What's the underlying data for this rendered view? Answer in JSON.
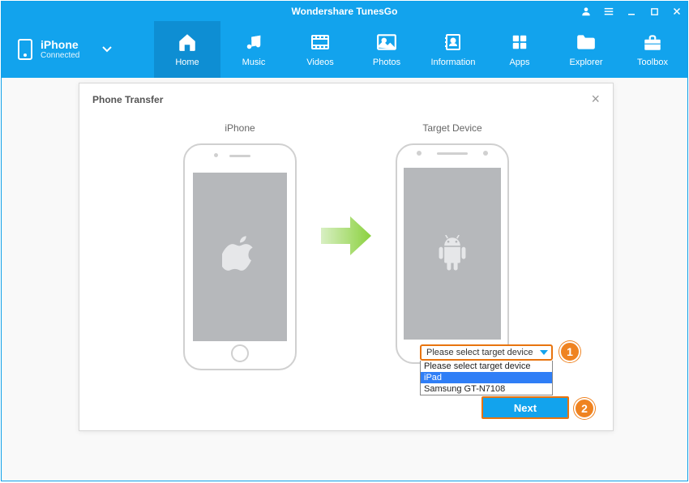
{
  "app": {
    "title": "Wondershare TunesGo"
  },
  "device": {
    "name": "iPhone",
    "status": "Connected"
  },
  "nav": {
    "items": [
      {
        "label": "Home"
      },
      {
        "label": "Music"
      },
      {
        "label": "Videos"
      },
      {
        "label": "Photos"
      },
      {
        "label": "Information"
      },
      {
        "label": "Apps"
      },
      {
        "label": "Explorer"
      },
      {
        "label": "Toolbox"
      }
    ]
  },
  "modal": {
    "title": "Phone Transfer",
    "source_label": "iPhone",
    "target_label": "Target Device",
    "next_label": "Next",
    "dropdown": {
      "selected": "Please select target device",
      "options": [
        "Please select target device",
        "iPad",
        "Samsung GT-N7108"
      ]
    },
    "badges": {
      "one": "1",
      "two": "2"
    }
  }
}
